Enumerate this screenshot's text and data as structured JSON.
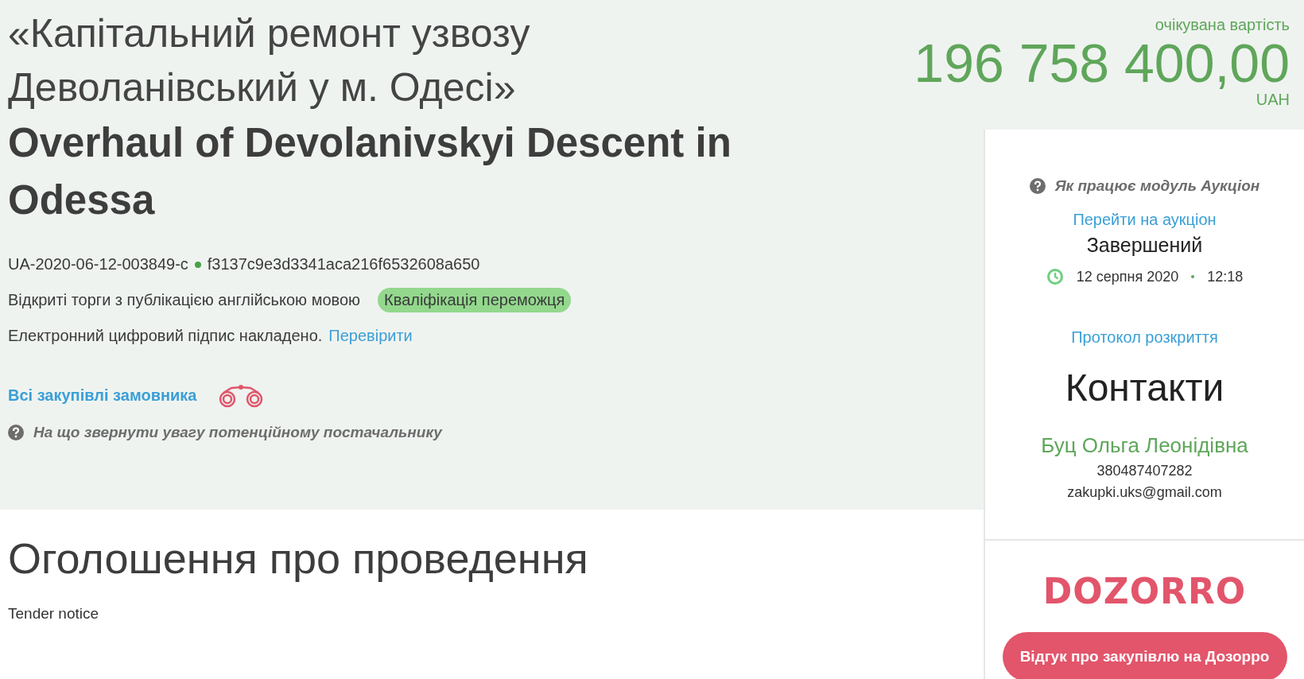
{
  "title_uk": "«Капітальний ремонт узвозу Деволанівський у м. Одесі»",
  "title_en": "Overhaul of Devolanivskyi Descent in Odessa",
  "tender_id": "UA-2020-06-12-003849-c",
  "hash": "f3137c9e3d3341aca216f6532608a650",
  "procedure": "Відкриті торги з публікацією англійською мовою",
  "status_badge": "Кваліфікація переможця",
  "signature": {
    "text": "Електронний цифровий підпис накладено.",
    "link": "Перевірити"
  },
  "customer_link": "Всі закупівлі замовника",
  "supplier_help": "На що звернути увагу потенційному постачальнику",
  "section": {
    "heading": "Оголошення про проведення",
    "subheading": "Tender notice"
  },
  "price": {
    "label": "очікувана вартість",
    "amount": "196 758 400,00",
    "currency": "UAH"
  },
  "auction": {
    "help": "Як працює модуль Аукціон",
    "link": "Перейти на аукціон",
    "status": "Завершений",
    "date": "12 серпня 2020",
    "time": "12:18"
  },
  "protocol_link": "Протокол розкриття",
  "contacts": {
    "heading": "Контакти",
    "name": "Буц Ольга Леонідівна",
    "phone": "380487407282",
    "email": "zakupki.uks@gmail.com"
  },
  "dozorro": {
    "logo": "DOZORRO",
    "button": "Відгук про закупівлю на Дозорро"
  }
}
